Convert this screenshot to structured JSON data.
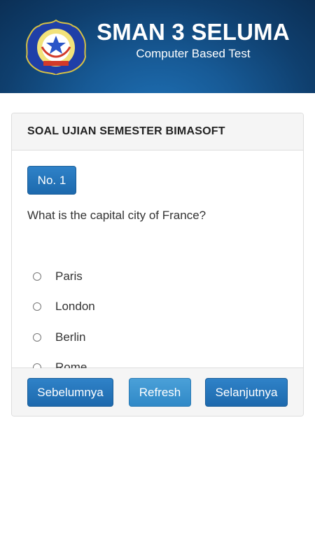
{
  "header": {
    "school_name": "SMAN 3 SELUMA",
    "subtitle": "Computer Based Test",
    "logo_text_top": "SMAN 3 SELUMA",
    "logo_icon": "school-emblem-icon",
    "background_color": "#134a7f"
  },
  "panel": {
    "title": "SOAL UJIAN SEMESTER BIMASOFT",
    "question_number": "No. 1",
    "question": "What is the capital city of France?",
    "options": [
      {
        "label": "Paris",
        "selected": false
      },
      {
        "label": "London",
        "selected": false
      },
      {
        "label": "Berlin",
        "selected": false
      },
      {
        "label": "Rome",
        "selected": false
      }
    ]
  },
  "footer": {
    "prev_label": "Sebelumnya",
    "refresh_label": "Refresh",
    "next_label": "Selanjutnya"
  },
  "colors": {
    "primary": "#2275ba",
    "info": "#3a93cf"
  }
}
